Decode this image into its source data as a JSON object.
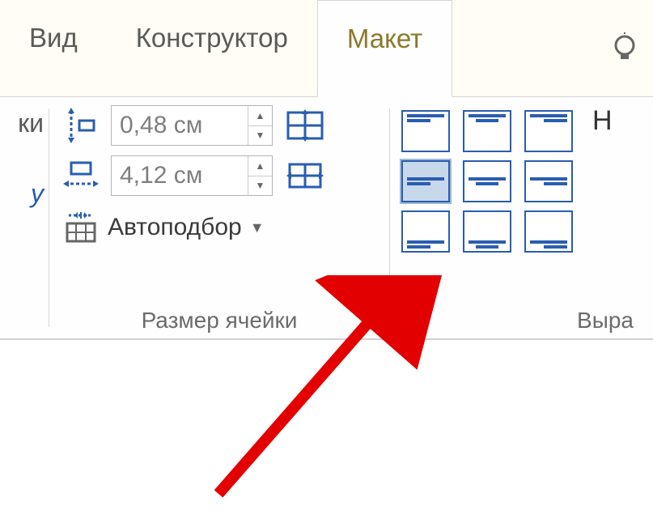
{
  "tabs": {
    "view": "Вид",
    "design": "Конструктор",
    "layout": "Макет"
  },
  "left_fragment": {
    "line1": "ки",
    "line2": "у"
  },
  "cellsize": {
    "height": "0,48 см",
    "width": "4,12 см",
    "autofit": "Автоподбор",
    "group_label": "Размер ячейки"
  },
  "align": {
    "group_label": "Выра",
    "right_frag": "Н"
  }
}
